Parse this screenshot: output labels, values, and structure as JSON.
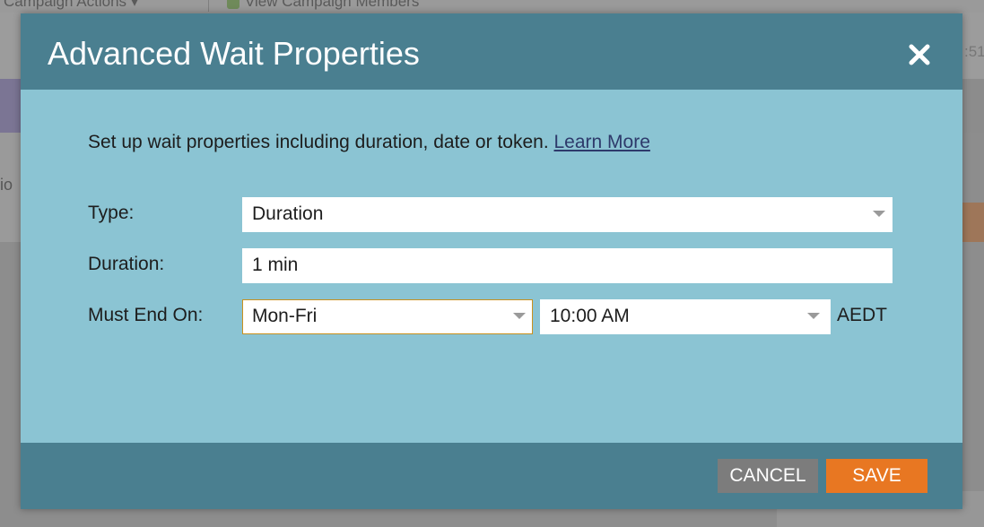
{
  "background": {
    "toolbar_item_1": "Campaign Actions",
    "toolbar_item_2": "View Campaign Members",
    "left_fragment": "io",
    "right_fragment": ":51"
  },
  "modal": {
    "title": "Advanced Wait Properties",
    "intro_text": "Set up wait properties including duration, date or token.",
    "learn_more": "Learn More",
    "fields": {
      "type": {
        "label": "Type:",
        "value": "Duration"
      },
      "duration": {
        "label": "Duration:",
        "value": "1 min"
      },
      "must_end_on": {
        "label": "Must End On:",
        "days_value": "Mon-Fri",
        "time_value": "10:00 AM",
        "timezone": "AEDT"
      }
    },
    "buttons": {
      "cancel": "CANCEL",
      "save": "SAVE"
    }
  },
  "colors": {
    "header": "#4a7f90",
    "body": "#8bc4d3",
    "save": "#e87722",
    "cancel": "#7c7c7c"
  },
  "icons": {
    "close": "close-icon",
    "dropdown": "chevron-down-icon"
  }
}
